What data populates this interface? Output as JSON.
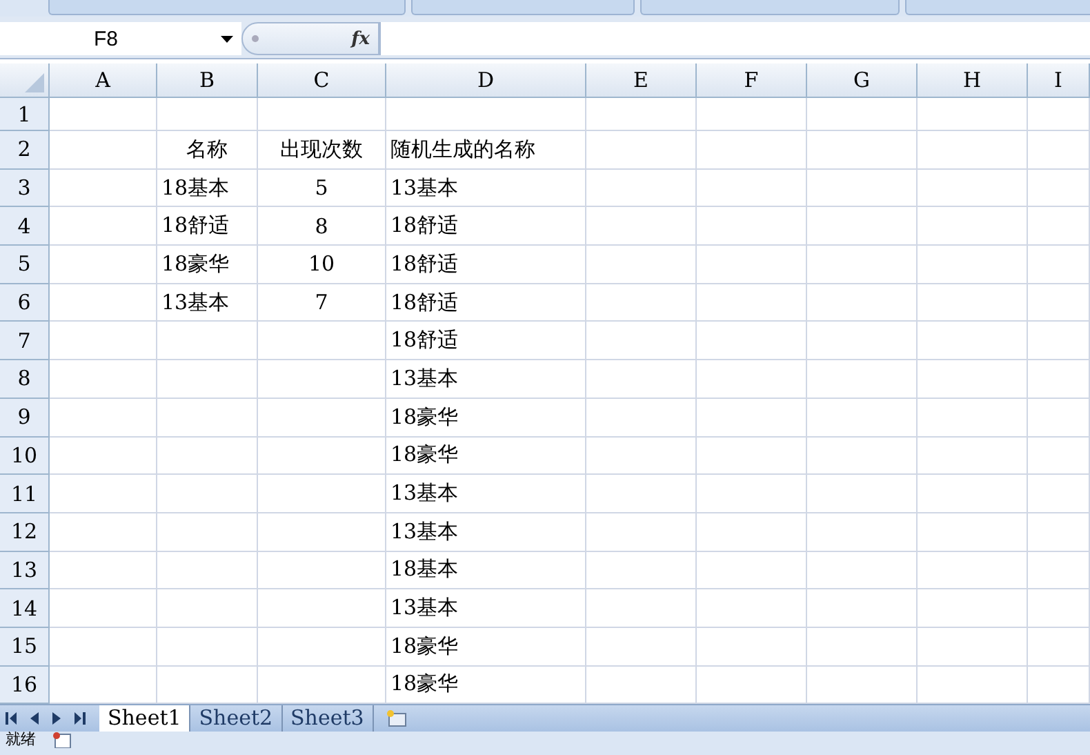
{
  "formula_bar": {
    "name_box": "F8",
    "fx": "fx"
  },
  "columns": [
    "A",
    "B",
    "C",
    "D",
    "E",
    "F",
    "G",
    "H",
    "I"
  ],
  "rows": [
    {
      "label": "1",
      "cells": [
        "",
        "",
        "",
        "",
        "",
        "",
        "",
        "",
        ""
      ]
    },
    {
      "label": "2",
      "cells": [
        "",
        "名称",
        "出现次数",
        "随机生成的名称",
        "",
        "",
        "",
        "",
        ""
      ]
    },
    {
      "label": "3",
      "cells": [
        "",
        "18基本",
        "5",
        "13基本",
        "",
        "",
        "",
        "",
        ""
      ]
    },
    {
      "label": "4",
      "cells": [
        "",
        "18舒适",
        "8",
        "18舒适",
        "",
        "",
        "",
        "",
        ""
      ]
    },
    {
      "label": "5",
      "cells": [
        "",
        "18豪华",
        "10",
        "18舒适",
        "",
        "",
        "",
        "",
        ""
      ]
    },
    {
      "label": "6",
      "cells": [
        "",
        "13基本",
        "7",
        "18舒适",
        "",
        "",
        "",
        "",
        ""
      ]
    },
    {
      "label": "7",
      "cells": [
        "",
        "",
        "",
        "18舒适",
        "",
        "",
        "",
        "",
        ""
      ]
    },
    {
      "label": "8",
      "cells": [
        "",
        "",
        "",
        "13基本",
        "",
        "",
        "",
        "",
        ""
      ]
    },
    {
      "label": "9",
      "cells": [
        "",
        "",
        "",
        "18豪华",
        "",
        "",
        "",
        "",
        ""
      ]
    },
    {
      "label": "10",
      "cells": [
        "",
        "",
        "",
        "18豪华",
        "",
        "",
        "",
        "",
        ""
      ]
    },
    {
      "label": "11",
      "cells": [
        "",
        "",
        "",
        "13基本",
        "",
        "",
        "",
        "",
        ""
      ]
    },
    {
      "label": "12",
      "cells": [
        "",
        "",
        "",
        "13基本",
        "",
        "",
        "",
        "",
        ""
      ]
    },
    {
      "label": "13",
      "cells": [
        "",
        "",
        "",
        "18基本",
        "",
        "",
        "",
        "",
        ""
      ]
    },
    {
      "label": "14",
      "cells": [
        "",
        "",
        "",
        "13基本",
        "",
        "",
        "",
        "",
        ""
      ]
    },
    {
      "label": "15",
      "cells": [
        "",
        "",
        "",
        "18豪华",
        "",
        "",
        "",
        "",
        ""
      ]
    },
    {
      "label": "16",
      "cells": [
        "",
        "",
        "",
        "18豪华",
        "",
        "",
        "",
        "",
        ""
      ]
    }
  ],
  "sheet_tabs": [
    {
      "label": "Sheet1",
      "selected": true
    },
    {
      "label": "Sheet2",
      "selected": false
    },
    {
      "label": "Sheet3",
      "selected": false
    }
  ],
  "status_bar": {
    "text": "就绪"
  }
}
